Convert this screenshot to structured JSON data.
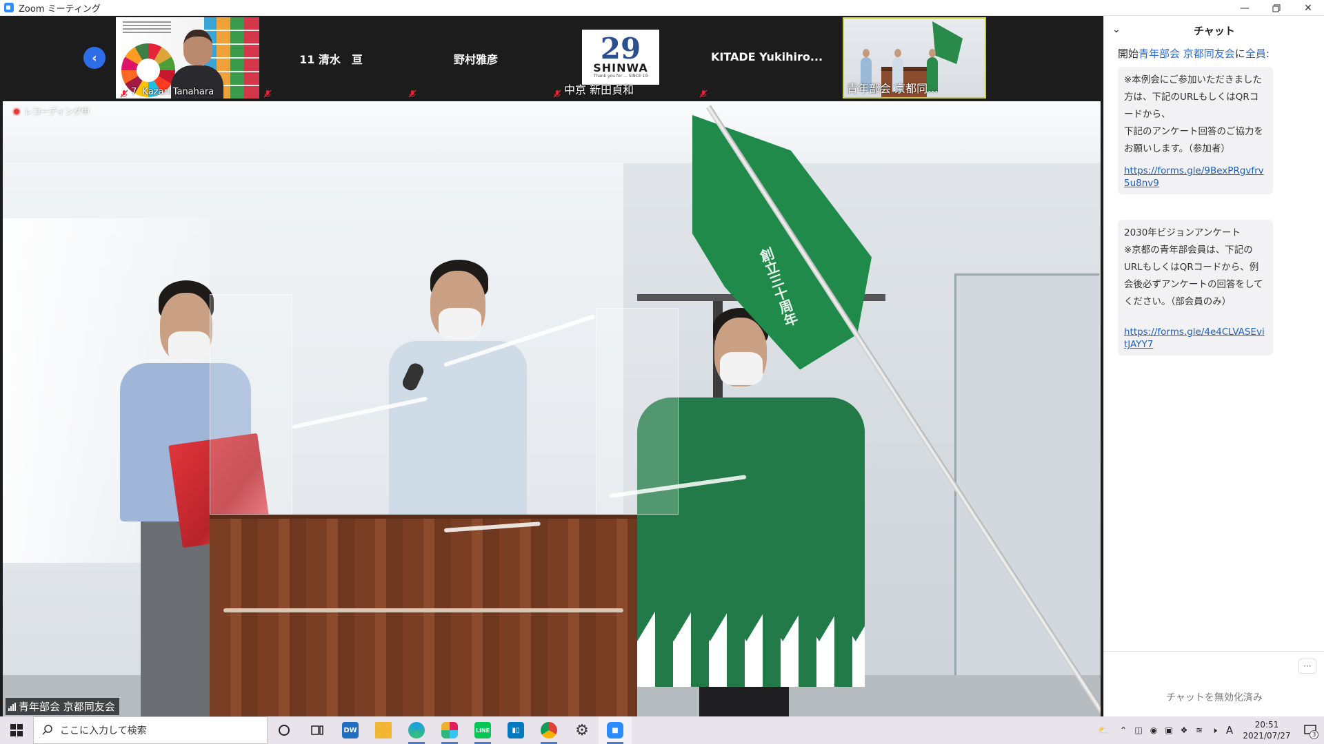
{
  "window": {
    "title": "Zoom ミーティング",
    "controls": [
      "minimize",
      "restore",
      "close"
    ]
  },
  "strip": {
    "prev_label": "‹",
    "tiles": [
      {
        "name": "Kazari Tanahara",
        "label_prefix": "7",
        "type": "video",
        "muted": true
      },
      {
        "name": "11 清水　亘",
        "type": "name-only",
        "muted": true
      },
      {
        "name": "野村雅彦",
        "type": "name-only",
        "muted": true
      },
      {
        "name": "中京 新田貞和",
        "type": "logo",
        "muted": true,
        "logo": {
          "number": "29",
          "brand": "SHINWA",
          "tagline": "Thank you for ... SINCE 19"
        }
      },
      {
        "name": "KITADE Yukihiro...",
        "type": "name-only",
        "muted": true
      },
      {
        "name": "青年部会 京都同...",
        "type": "video",
        "muted": false,
        "active": true
      }
    ]
  },
  "main_video": {
    "recording_label": "レコーディング中",
    "speaker_name": "青年部会 京都同友会",
    "flag_text": "創立三十周年"
  },
  "chat": {
    "title": "チャット",
    "to_prefix": "開始",
    "to_group": "青年部会 京都同友会",
    "to_mid": "に",
    "to_target": "全員",
    "to_suffix": ":",
    "messages": [
      {
        "text_lines": [
          "※本例会にご参加いただきました方は、下記のURLもしくはQRコードから、",
          "下記のアンケート回答のご協力をお願いします。（参加者）"
        ],
        "link": "https://forms.gle/9BexPRgvfrv5u8nv9"
      },
      {
        "text_lines": [
          "2030年ビジョンアンケート",
          "※京都の青年部会員は、下記のURLもしくはQRコードから、例会後必ずアンケートの回答をしてください。（部会員のみ）"
        ],
        "link": "https://forms.gle/4e4CLVASEvitJAYY7"
      }
    ],
    "more_label": "···",
    "disabled_label": "チャットを無効化済み"
  },
  "taskbar": {
    "search_placeholder": "ここに入力して検索",
    "apps": [
      "cortana",
      "task-view",
      "dw",
      "file-explorer",
      "edge",
      "slack",
      "line",
      "trello",
      "chrome",
      "settings",
      "zoom"
    ],
    "clock_time": "20:51",
    "clock_date": "2021/07/27",
    "ime_label": "A",
    "notification_count": "3"
  },
  "colors": {
    "zoom_blue": "#2d8cff",
    "chat_link": "#1f5fbf",
    "flag_green": "#1f8a4a",
    "recording_red": "#e03a3a"
  }
}
